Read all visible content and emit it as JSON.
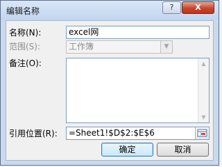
{
  "window": {
    "title": "编辑名称",
    "help_label": "?",
    "close_label": "X"
  },
  "form": {
    "name_label": "名称(N):",
    "name_value": "excel网",
    "scope_label": "范围(S):",
    "scope_value": "工作簿",
    "comment_label": "备注(O):",
    "comment_value": "",
    "refers_label": "引用位置(R):",
    "refers_value": "=Sheet1!$D$2:$E$6"
  },
  "buttons": {
    "ok_label": "确定",
    "cancel_label": "取消"
  },
  "icons": {
    "help": "help-icon",
    "close": "close-icon",
    "dropdown": "chevron-down-icon",
    "collapse_dialog": "collapse-dialog-icon",
    "scroll_up": "scroll-up-icon",
    "scroll_down": "scroll-down-icon"
  },
  "colors": {
    "close_button": "#c8452c",
    "default_button_border": "#3c7fb1",
    "field_border": "#7f9db9"
  }
}
